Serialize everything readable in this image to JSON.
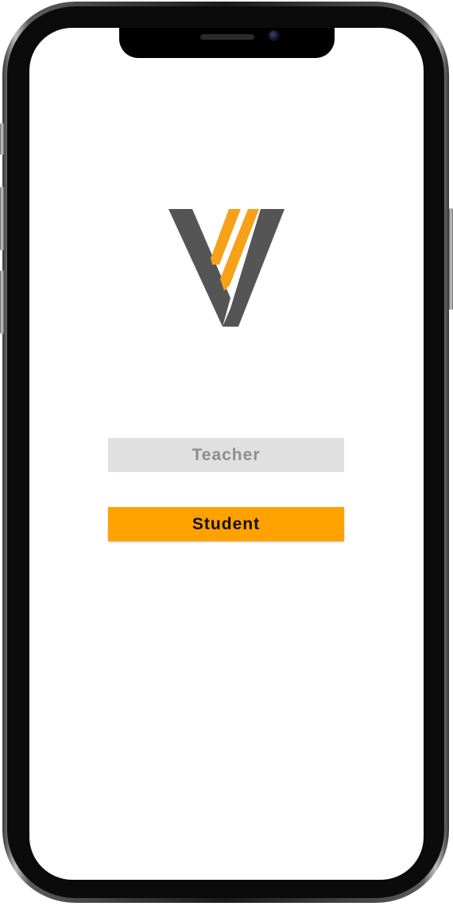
{
  "app": {
    "logo_icon": "v-logo-icon",
    "brand_colors": {
      "gray": "#555555",
      "orange": "#f7a11a"
    }
  },
  "buttons": {
    "teacher_label": "Teacher",
    "student_label": "Student"
  },
  "colors": {
    "teacher_bg": "#e0e0e0",
    "teacher_text": "#8e8e8e",
    "student_bg": "#ffa200",
    "student_text": "#111111"
  }
}
